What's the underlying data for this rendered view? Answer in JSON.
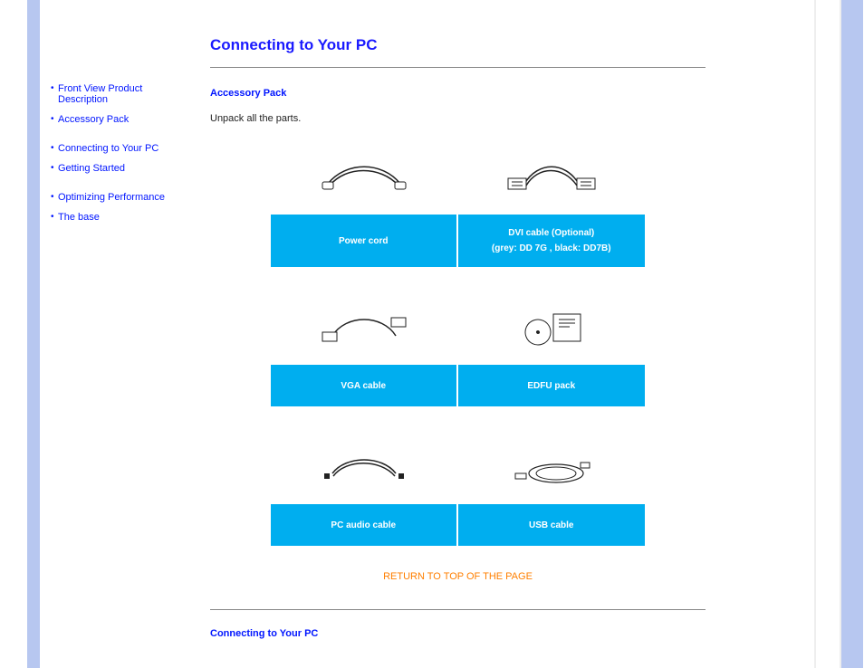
{
  "sidebar": {
    "items": [
      {
        "label": "Front View Product Description"
      },
      {
        "label": "Accessory Pack"
      },
      {
        "label": "Connecting to Your PC"
      },
      {
        "label": "Getting Started"
      },
      {
        "label": "Optimizing Performance"
      },
      {
        "label": "The base"
      }
    ]
  },
  "page": {
    "title": "Connecting to Your PC",
    "accessory_heading": "Accessory Pack",
    "intro": "Unpack all the parts.",
    "rows": [
      {
        "left": {
          "name": "power-cord",
          "label1": "Power cord",
          "label2": ""
        },
        "right": {
          "name": "dvi-cable",
          "label1": "DVI cable (Optional)",
          "label2": "(grey: DD 7G , black: DD7B)"
        }
      },
      {
        "left": {
          "name": "vga-cable",
          "label1": "VGA cable",
          "label2": ""
        },
        "right": {
          "name": "edfu-pack",
          "label1": "EDFU pack",
          "label2": ""
        }
      },
      {
        "left": {
          "name": "pc-audio-cable",
          "label1": "PC audio cable",
          "label2": ""
        },
        "right": {
          "name": "usb-cable",
          "label1": "USB cable",
          "label2": ""
        }
      }
    ],
    "return_link": "RETURN TO TOP OF THE PAGE",
    "section2_heading": "Connecting to Your PC"
  }
}
